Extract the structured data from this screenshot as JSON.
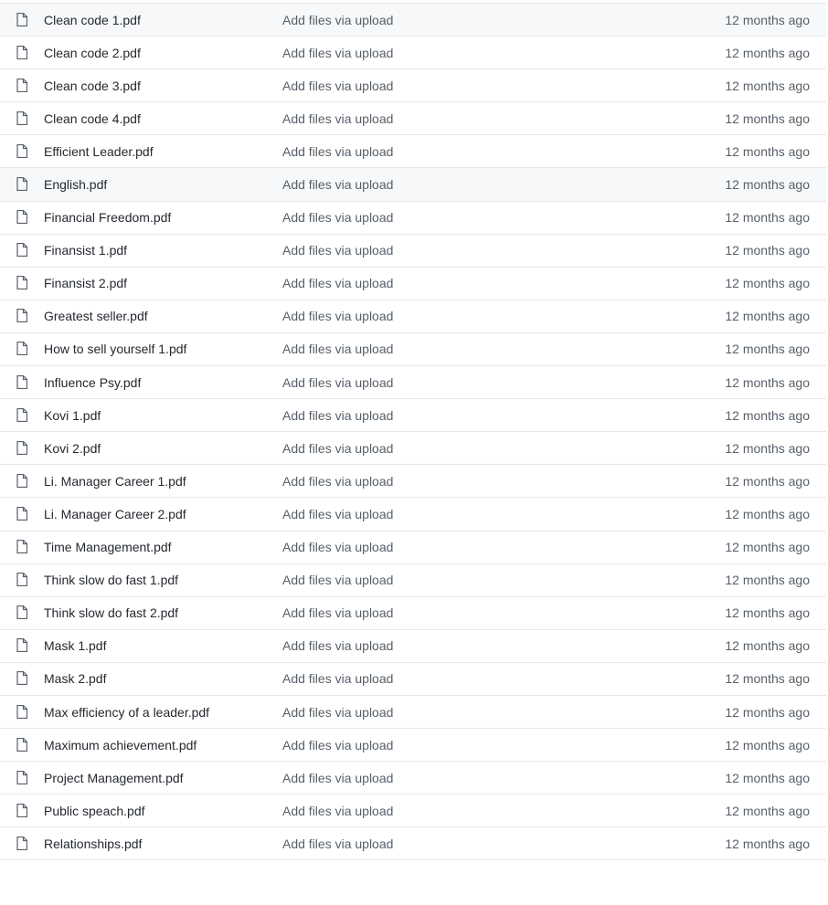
{
  "file_list": {
    "icon": "file-icon",
    "colors": {
      "text": "#24292f",
      "muted": "#57606a",
      "border": "#e6e9ec",
      "highlight": "#f6f8fa"
    },
    "rows": [
      {
        "name": "Clean code 1.pdf",
        "commit": "Add files via upload",
        "age": "12 months ago"
      },
      {
        "name": "Clean code 2.pdf",
        "commit": "Add files via upload",
        "age": "12 months ago"
      },
      {
        "name": "Clean code 3.pdf",
        "commit": "Add files via upload",
        "age": "12 months ago"
      },
      {
        "name": "Clean code 4.pdf",
        "commit": "Add files via upload",
        "age": "12 months ago"
      },
      {
        "name": "Efficient Leader.pdf",
        "commit": "Add files via upload",
        "age": "12 months ago"
      },
      {
        "name": "English.pdf",
        "commit": "Add files via upload",
        "age": "12 months ago"
      },
      {
        "name": "Financial Freedom.pdf",
        "commit": "Add files via upload",
        "age": "12 months ago"
      },
      {
        "name": "Finansist 1.pdf",
        "commit": "Add files via upload",
        "age": "12 months ago"
      },
      {
        "name": "Finansist 2.pdf",
        "commit": "Add files via upload",
        "age": "12 months ago"
      },
      {
        "name": "Greatest seller.pdf",
        "commit": "Add files via upload",
        "age": "12 months ago"
      },
      {
        "name": "How to sell yourself 1.pdf",
        "commit": "Add files via upload",
        "age": "12 months ago"
      },
      {
        "name": "Influence Psy.pdf",
        "commit": "Add files via upload",
        "age": "12 months ago"
      },
      {
        "name": "Kovi 1.pdf",
        "commit": "Add files via upload",
        "age": "12 months ago"
      },
      {
        "name": "Kovi 2.pdf",
        "commit": "Add files via upload",
        "age": "12 months ago"
      },
      {
        "name": "Li. Manager Career 1.pdf",
        "commit": "Add files via upload",
        "age": "12 months ago"
      },
      {
        "name": "Li. Manager Career 2.pdf",
        "commit": "Add files via upload",
        "age": "12 months ago"
      },
      {
        "name": "Time Management.pdf",
        "commit": "Add files via upload",
        "age": "12 months ago"
      },
      {
        "name": "Think slow do fast 1.pdf",
        "commit": "Add files via upload",
        "age": "12 months ago"
      },
      {
        "name": "Think slow do fast 2.pdf",
        "commit": "Add files via upload",
        "age": "12 months ago"
      },
      {
        "name": "Mask 1.pdf",
        "commit": "Add files via upload",
        "age": "12 months ago"
      },
      {
        "name": "Mask 2.pdf",
        "commit": "Add files via upload",
        "age": "12 months ago"
      },
      {
        "name": "Max efficiency of a leader.pdf",
        "commit": "Add files via upload",
        "age": "12 months ago"
      },
      {
        "name": "Maximum achievement.pdf",
        "commit": "Add files via upload",
        "age": "12 months ago"
      },
      {
        "name": "Project Management.pdf",
        "commit": "Add files via upload",
        "age": "12 months ago"
      },
      {
        "name": "Public speach.pdf",
        "commit": "Add files via upload",
        "age": "12 months ago"
      },
      {
        "name": "Relationships.pdf",
        "commit": "Add files via upload",
        "age": "12 months ago"
      }
    ]
  }
}
